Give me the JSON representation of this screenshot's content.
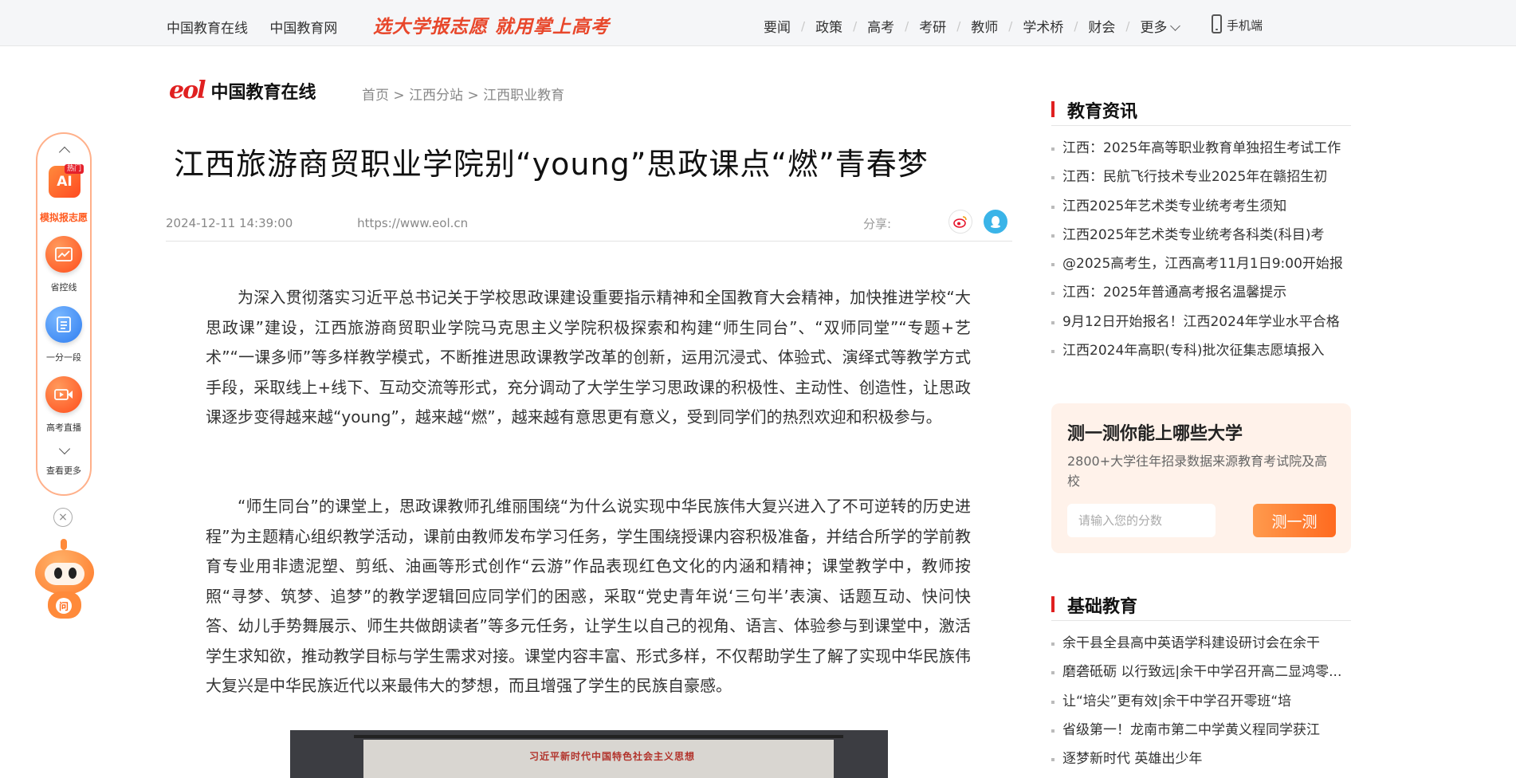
{
  "topbar": {
    "site_links": [
      "中国教育在线",
      "中国教育网"
    ],
    "slogan": "选大学报志愿 就用掌上高考",
    "nav": [
      "要闻",
      "政策",
      "高考",
      "考研",
      "教师",
      "学术桥",
      "财会"
    ],
    "more_label": "更多",
    "mobile_label": "手机端"
  },
  "logo": {
    "mark": "eol",
    "text": "中国教育在线"
  },
  "breadcrumb": {
    "home": "首页",
    "sep": ">",
    "station": "江西分站",
    "category": "江西职业教育"
  },
  "article": {
    "title": "江西旅游商贸职业学院别“young”思政课点“燃”青春梦",
    "date": "2024-12-11 14:39:00",
    "source": "https://www.eol.cn",
    "share_label": "分享:",
    "paragraphs": [
      "为深入贯彻落实习近平总书记关于学校思政课建设重要指示精神和全国教育大会精神，加快推进学校“大思政课”建设，江西旅游商贸职业学院马克思主义学院积极探索和构建“师生同台”、“双师同堂”“专题+艺术”“一课多师”等多样教学模式，不断推进思政课教学改革的创新，运用沉浸式、体验式、演绎式等教学方式手段，采取线上+线下、互动交流等形式，充分调动了大学生学习思政课的积极性、主动性、创造性，让思政课逐步变得越来越“young”，越来越“燃”，越来越有意思更有意义，受到同学们的热烈欢迎和积极参与。",
      "“师生同台”的课堂上，思政课教师孔维丽围绕“为什么说实现中华民族伟大复兴进入了不可逆转的历史进程”为主题精心组织教学活动，课前由教师发布学习任务，学生围绕授课内容积极准备，并结合所学的学前教育专业用非遗泥塑、剪纸、油画等形式创作“云游”作品表现红色文化的内涵和精神；课堂教学中，教师按照“寻梦、筑梦、追梦”的教学逻辑回应同学们的困惑，采取“党史青年说‘三句半’表演、话题互动、快问快答、幼儿手势舞展示、师生共做朗读者”等多元任务，让学生以自己的视角、语言、体验参与到课堂中，激活学生求知欲，推动教学目标与学生需求对接。课堂内容丰富、形式多样，不仅帮助学生了解了实现中华民族伟大复兴是中华民族近代以来最伟大的梦想，而且增强了学生的民族自豪感。"
    ],
    "photo_caption": "习近平新时代中国特色社会主义思想"
  },
  "float_bar": {
    "ai_label": "AI",
    "hot_badge": "热门",
    "items": [
      "模拟报志愿",
      "省控线",
      "一分一段",
      "高考直播",
      "查看更多"
    ],
    "close": "×",
    "mascot_badge": "问"
  },
  "sidebar": {
    "news_title": "教育资讯",
    "news": [
      "江西：2025年高等职业教育单独招生考试工作",
      "江西：民航飞行技术专业2025年在赣招生初",
      "江西2025年艺术类专业统考考生须知",
      "江西2025年艺术类专业统考各科类(科目)考",
      "@2025高考生，江西高考11月1日9:00开始报",
      "江西：2025年普通高考报名温馨提示",
      "9月12日开始报名！江西2024年学业水平合格",
      "江西2024年高职(专科)批次征集志愿填报入"
    ],
    "quiz": {
      "title": "测一测你能上哪些大学",
      "desc": "2800+大学往年招录数据来源教育考试院及高校",
      "placeholder": "请输入您的分数",
      "button": "测一测"
    },
    "basic_title": "基础教育",
    "basic": [
      "余干县全县高中英语学科建设研讨会在余干",
      "磨砻砥砺 以行致远|余干中学召开高二显鸿零...",
      "让“培尖”更有效|余干中学召开零班“培",
      "省级第一！龙南市第二中学黄义程同学获江",
      "逐梦新时代 英雄出少年"
    ]
  },
  "colors": {
    "accent": "#e02020",
    "orange": "#ff6a1f",
    "quiz_bg": "#fff2ea"
  },
  "icons": [
    "phone-icon",
    "weibo-icon",
    "qq-icon",
    "chart-icon",
    "list-icon",
    "video-icon",
    "chevron-up-icon",
    "chevron-down-icon",
    "close-icon"
  ]
}
